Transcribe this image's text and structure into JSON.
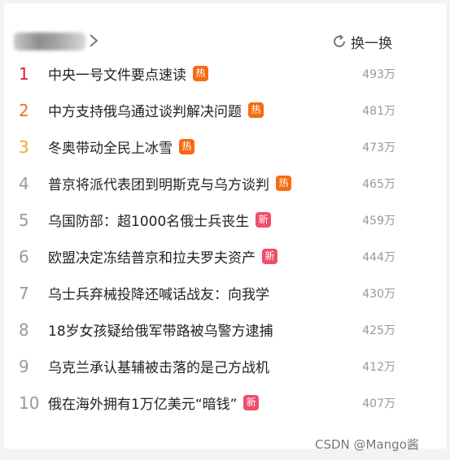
{
  "header": {
    "refresh_label": "换一换"
  },
  "colors": {
    "rank_1": "#e6163f",
    "rank_2": "#f26d1f",
    "rank_3": "#f5a623",
    "rank_default": "#999999",
    "badge_hot": "#f86a11",
    "badge_new": "#f04e6b"
  },
  "items": [
    {
      "rank": "1",
      "title": "中央一号文件要点速读",
      "badge": "热",
      "badge_type": "hot",
      "count": "493万"
    },
    {
      "rank": "2",
      "title": "中方支持俄乌通过谈判解决问题",
      "badge": "热",
      "badge_type": "hot",
      "count": "481万"
    },
    {
      "rank": "3",
      "title": "冬奥带动全民上冰雪",
      "badge": "热",
      "badge_type": "hot",
      "count": "473万"
    },
    {
      "rank": "4",
      "title": "普京将派代表团到明斯克与乌方谈判",
      "badge": "热",
      "badge_type": "hot",
      "count": "465万"
    },
    {
      "rank": "5",
      "title": "乌国防部：超1000名俄士兵丧生",
      "badge": "新",
      "badge_type": "new",
      "count": "459万"
    },
    {
      "rank": "6",
      "title": "欧盟决定冻结普京和拉夫罗夫资产",
      "badge": "新",
      "badge_type": "new",
      "count": "444万"
    },
    {
      "rank": "7",
      "title": "乌士兵弃械投降还喊话战友：向我学",
      "badge": "",
      "badge_type": "",
      "count": "430万"
    },
    {
      "rank": "8",
      "title": "18岁女孩疑给俄军带路被乌警方逮捕",
      "badge": "",
      "badge_type": "",
      "count": "425万"
    },
    {
      "rank": "9",
      "title": "乌克兰承认基辅被击落的是己方战机",
      "badge": "",
      "badge_type": "",
      "count": "412万"
    },
    {
      "rank": "10",
      "title": "俄在海外拥有1万亿美元“暗钱”",
      "badge": "新",
      "badge_type": "new",
      "count": "407万"
    }
  ],
  "watermark": "CSDN @Mango酱"
}
